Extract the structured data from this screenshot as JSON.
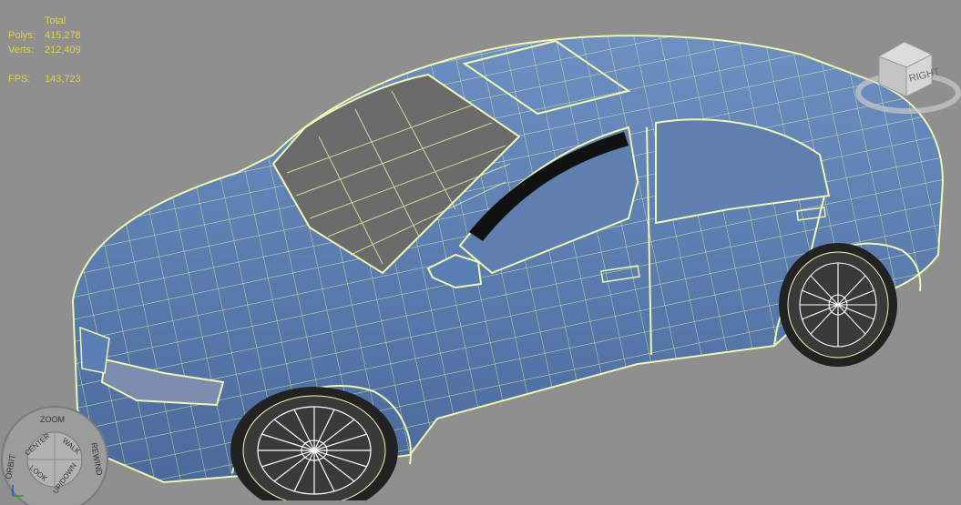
{
  "stats": {
    "header": "Total",
    "polys_label": "Polys:",
    "polys_value": "415,278",
    "verts_label": "Verts:",
    "verts_value": "212,409",
    "fps_label": "FPS:",
    "fps_value": "143,723"
  },
  "viewcube": {
    "face_label": "RIGHT"
  },
  "steering_wheel": {
    "zoom": "ZOOM",
    "orbit": "ORBIT",
    "center": "CENTER",
    "walk": "WALK",
    "rewind": "REWIND",
    "look": "LOOK",
    "updown": "UP/DOWN"
  },
  "colors": {
    "background": "#8f8f8f",
    "stats_text": "#e0d23a",
    "car_body": "#5a7fb4",
    "wireframe": "#e6f2a0",
    "glass": "#6b6b6b"
  }
}
